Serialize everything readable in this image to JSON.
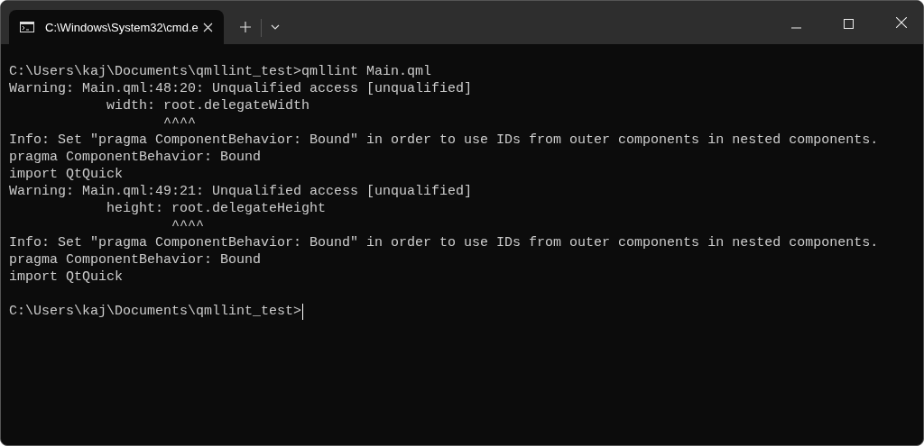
{
  "tabs": [
    {
      "title": "C:\\Windows\\System32\\cmd.e",
      "selected": true
    }
  ],
  "lines": [
    {
      "kind": "text",
      "text": "C:\\Users\\kaj\\Documents\\qmllint_test>qmllint Main.qml"
    },
    {
      "kind": "text",
      "text": "Warning: Main.qml:48:20: Unqualified access [unqualified]"
    },
    {
      "kind": "text",
      "text": "            width: root.delegateWidth"
    },
    {
      "kind": "text",
      "text": "                   ^^^^"
    },
    {
      "kind": "text",
      "text": "Info: Set \"pragma ComponentBehavior: Bound\" in order to use IDs from outer components in nested components."
    },
    {
      "kind": "text",
      "text": "pragma ComponentBehavior: Bound"
    },
    {
      "kind": "text",
      "text": "import QtQuick"
    },
    {
      "kind": "text",
      "text": "Warning: Main.qml:49:21: Unqualified access [unqualified]"
    },
    {
      "kind": "text",
      "text": "            height: root.delegateHeight"
    },
    {
      "kind": "text",
      "text": "                    ^^^^"
    },
    {
      "kind": "text",
      "text": "Info: Set \"pragma ComponentBehavior: Bound\" in order to use IDs from outer components in nested components."
    },
    {
      "kind": "text",
      "text": "pragma ComponentBehavior: Bound"
    },
    {
      "kind": "text",
      "text": "import QtQuick"
    },
    {
      "kind": "blank"
    },
    {
      "kind": "prompt",
      "text": "C:\\Users\\kaj\\Documents\\qmllint_test>"
    }
  ]
}
